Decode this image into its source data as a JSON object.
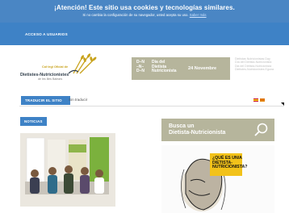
{
  "cookie_notice": {
    "title": "¡Atención! Este sitio usa cookies y tecnologías similares.",
    "subtitle": "Si no cambia la configuración de su navegador, usted acepta su uso.",
    "link_label": "Saber más"
  },
  "nav": {
    "access_label": "ACCESO A USUARIOS"
  },
  "logo": {
    "line1": "Col·legi Oficial de",
    "line2": "Dietistes-Nutricionistes",
    "line3": "de les Illes Balears"
  },
  "banner": {
    "letters": [
      "D–N",
      "–N–",
      "D–N"
    ],
    "words": [
      "Dia del",
      "Dietista",
      "Nutricionista"
    ],
    "date": "24 Novembre"
  },
  "banner_side": {
    "lines": [
      "Dietistas Nutricionistas Day",
      "Día del Dietista-Nutricionista",
      "Dia del Dietista-Nutricionista",
      "Dietistes-Nutricionistes Eguna"
    ]
  },
  "translate_bar": {
    "label": "TRADUCIR EL SITIO",
    "value": "Sin traducir",
    "flag_colors": [
      "#c8102e",
      "#f1bf00"
    ]
  },
  "news": {
    "label": "NOTICIAS"
  },
  "search": {
    "title_line1": "Busca un",
    "title_line2": "Dietista-Nutricionista"
  },
  "promo": {
    "question": [
      "¿QUÉ ES UN/A",
      "DIETISTA-",
      "NUTRICIONISTA?"
    ]
  },
  "colors": {
    "blue": "#3e82c6",
    "cookie_blue": "#4a86c4",
    "olive": "#b6b59c",
    "gold": "#c8a21b",
    "yellow": "#f2c21a"
  }
}
